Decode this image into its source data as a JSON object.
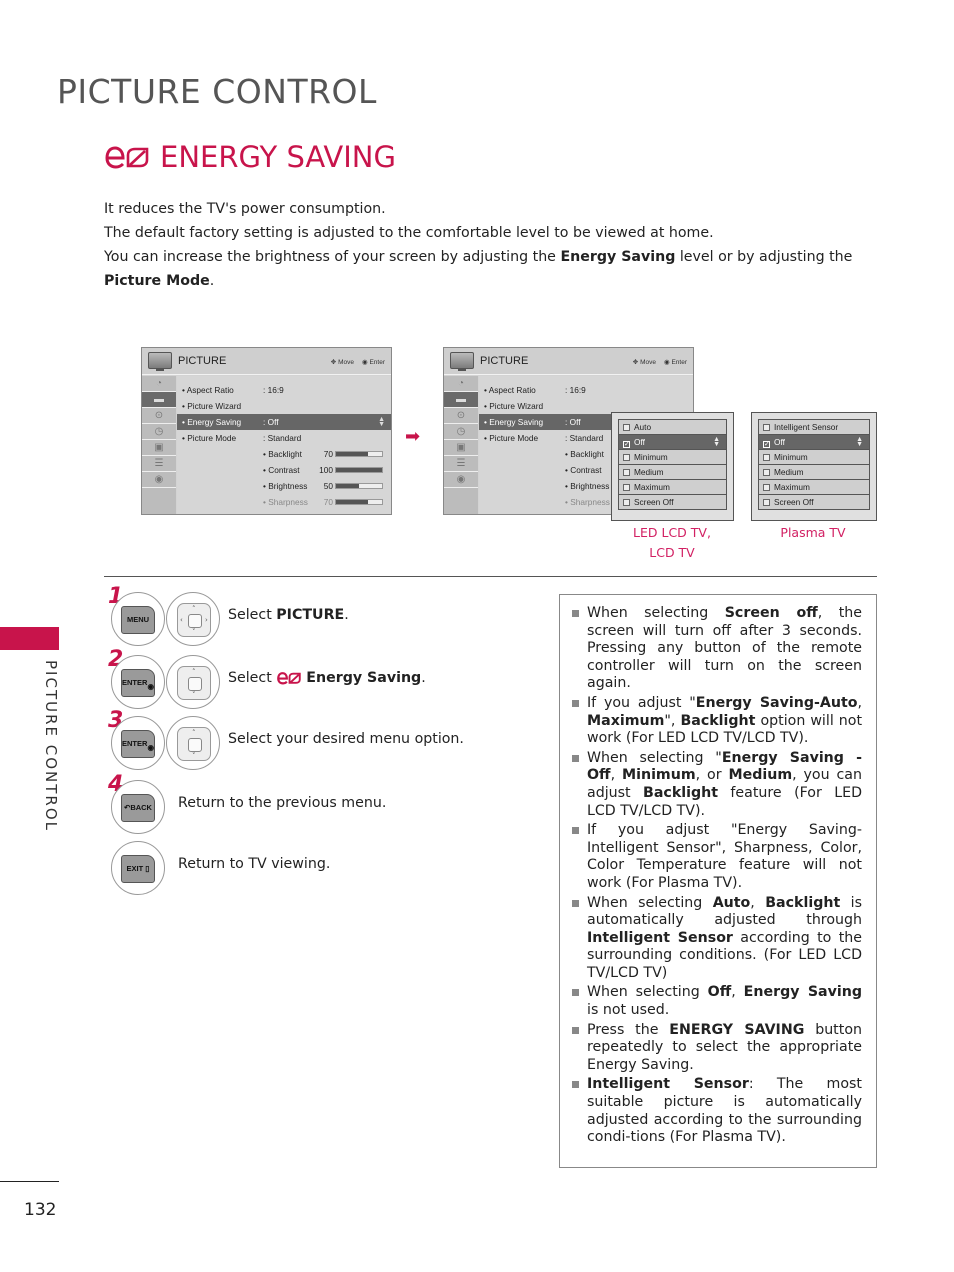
{
  "page": {
    "title": "PICTURE CONTROL",
    "section_title": "ENERGY SAVING",
    "side_label": "PICTURE CONTROL",
    "page_number": "132",
    "accent_color": "#c8144b"
  },
  "intro": {
    "line1": "It reduces the TV's power consumption.",
    "line2": "The default factory setting is adjusted to the comfortable level to be viewed at home.",
    "line3_pre": "You can increase the brightness of your screen by adjusting the ",
    "line3_bold1": "Energy Saving",
    "line3_mid": " level or by adjusting the ",
    "line3_bold2": "Picture Mode",
    "line3_post": "."
  },
  "tv_menu": {
    "title": "PICTURE",
    "help_move": "Move",
    "help_enter": "Enter",
    "rows": [
      {
        "label": "• Aspect Ratio",
        "value": ": 16:9"
      },
      {
        "label": "• Picture Wizard",
        "value": ""
      },
      {
        "label": "• Energy Saving",
        "value": ": Off"
      },
      {
        "label": "• Picture Mode",
        "value": ": Standard"
      }
    ],
    "sliders": [
      {
        "label": "• Backlight",
        "value": "70",
        "level": 0.7
      },
      {
        "label": "• Contrast",
        "value": "100",
        "level": 1.0
      },
      {
        "label": "• Brightness",
        "value": "50",
        "level": 0.5
      },
      {
        "label": "• Sharpness",
        "value": "70",
        "level": 0.7
      }
    ]
  },
  "led_popup": {
    "caption_line1": "LED LCD TV,",
    "caption_line2": "LCD TV",
    "options": [
      "Auto",
      "Off",
      "Minimum",
      "Medium",
      "Maximum",
      "Screen Off"
    ],
    "selected": "Off"
  },
  "plasma_popup": {
    "caption": "Plasma TV",
    "options": [
      "Intelligent Sensor",
      "Off",
      "Minimum",
      "Medium",
      "Maximum",
      "Screen Off"
    ],
    "selected": "Off"
  },
  "steps": [
    {
      "num": "1",
      "key": "MENU",
      "text_pre": "Select ",
      "text_bold": "PICTURE",
      "text_post": "."
    },
    {
      "num": "2",
      "key": "ENTER",
      "text_pre": "Select ",
      "text_bold": "Energy Saving",
      "text_post": "."
    },
    {
      "num": "3",
      "key": "ENTER",
      "text_pre": "Select your desired menu option.",
      "text_bold": "",
      "text_post": ""
    },
    {
      "num": "4",
      "key": "BACK",
      "text_pre": "Return to the previous menu.",
      "text_bold": "",
      "text_post": ""
    },
    {
      "num": "",
      "key": "EXIT",
      "text_pre": "Return to TV viewing.",
      "text_bold": "",
      "text_post": ""
    }
  ],
  "notes": [
    {
      "parts": [
        [
          "When selecting ",
          0
        ],
        [
          "Screen off",
          1
        ],
        [
          ", the screen will turn off after 3 seconds. Pressing any button of the remote controller will turn on the screen again.",
          0
        ]
      ]
    },
    {
      "parts": [
        [
          "If you adjust \"",
          0
        ],
        [
          "Energy Saving-Auto",
          1
        ],
        [
          ", ",
          0
        ],
        [
          "Maximum",
          1
        ],
        [
          "\", ",
          0
        ],
        [
          "Backlight",
          1
        ],
        [
          " option will not work (For LED LCD TV/LCD TV).",
          0
        ]
      ]
    },
    {
      "parts": [
        [
          "When selecting \"",
          0
        ],
        [
          "Energy Saving - Off",
          1
        ],
        [
          ", ",
          0
        ],
        [
          "Minimum",
          1
        ],
        [
          ",  or ",
          0
        ],
        [
          "Medium",
          1
        ],
        [
          ", you can adjust ",
          0
        ],
        [
          "Backlight",
          1
        ],
        [
          " feature (For LED LCD TV/LCD TV).",
          0
        ]
      ]
    },
    {
      "parts": [
        [
          "If you adjust \"Energy Saving-Intelligent Sensor\", Sharpness, Color, Color Temperature feature will not work (For Plasma TV).",
          0
        ]
      ]
    },
    {
      "parts": [
        [
          "When selecting ",
          0
        ],
        [
          "Auto",
          1
        ],
        [
          ", ",
          0
        ],
        [
          "Backlight",
          1
        ],
        [
          " is automatically adjusted through ",
          0
        ],
        [
          "Intelligent Sensor",
          1
        ],
        [
          " according to the surrounding conditions. (For LED LCD TV/LCD TV)",
          0
        ]
      ]
    },
    {
      "parts": [
        [
          "When selecting ",
          0
        ],
        [
          "Off",
          1
        ],
        [
          ", ",
          0
        ],
        [
          "Energy Saving",
          1
        ],
        [
          " is not used.",
          0
        ]
      ]
    },
    {
      "parts": [
        [
          "Press the ",
          0
        ],
        [
          "ENERGY SAVING",
          1
        ],
        [
          " button repeatedly to select the appropriate Energy Saving.",
          0
        ]
      ]
    },
    {
      "parts": [
        [
          "Intelligent Sensor",
          1
        ],
        [
          ": The most suitable picture is automatically adjusted according to the surrounding condi-tions (For Plasma TV).",
          0
        ]
      ]
    }
  ]
}
